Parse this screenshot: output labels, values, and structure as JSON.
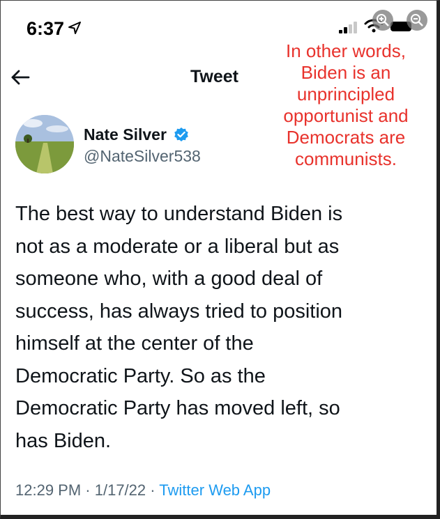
{
  "status_bar": {
    "time": "6:37",
    "location_icon": "location-arrow-icon",
    "signal_icon": "cellular-signal-icon",
    "wifi_icon": "wifi-icon",
    "battery_icon": "battery-icon",
    "zoom_in_icon": "zoom-in-icon",
    "zoom_out_icon": "zoom-out-icon"
  },
  "header": {
    "back_icon": "back-arrow-icon",
    "title": "Tweet"
  },
  "annotation": {
    "lines": [
      "In other words,",
      "Biden is an",
      "unprincipled",
      "opportunist and",
      "Democrats are",
      "communists."
    ],
    "color": "#e8322c"
  },
  "author": {
    "name": "Nate Silver",
    "handle": "@NateSilver538",
    "verified_icon": "verified-badge-icon",
    "verified_color": "#1d9bf0"
  },
  "tweet": {
    "lines": [
      "The best way to understand Biden is",
      "not as a moderate or a liberal but as",
      "someone who, with a good deal of",
      "success, has always tried to position",
      "himself at the center of the",
      "Democratic Party. So as the",
      "Democratic Party has moved left, so",
      "has Biden."
    ]
  },
  "meta": {
    "time": "12:29 PM",
    "sep1": " · ",
    "date": "1/17/22",
    "sep2": " · ",
    "source": "Twitter Web App",
    "link_color": "#1d9bf0"
  }
}
